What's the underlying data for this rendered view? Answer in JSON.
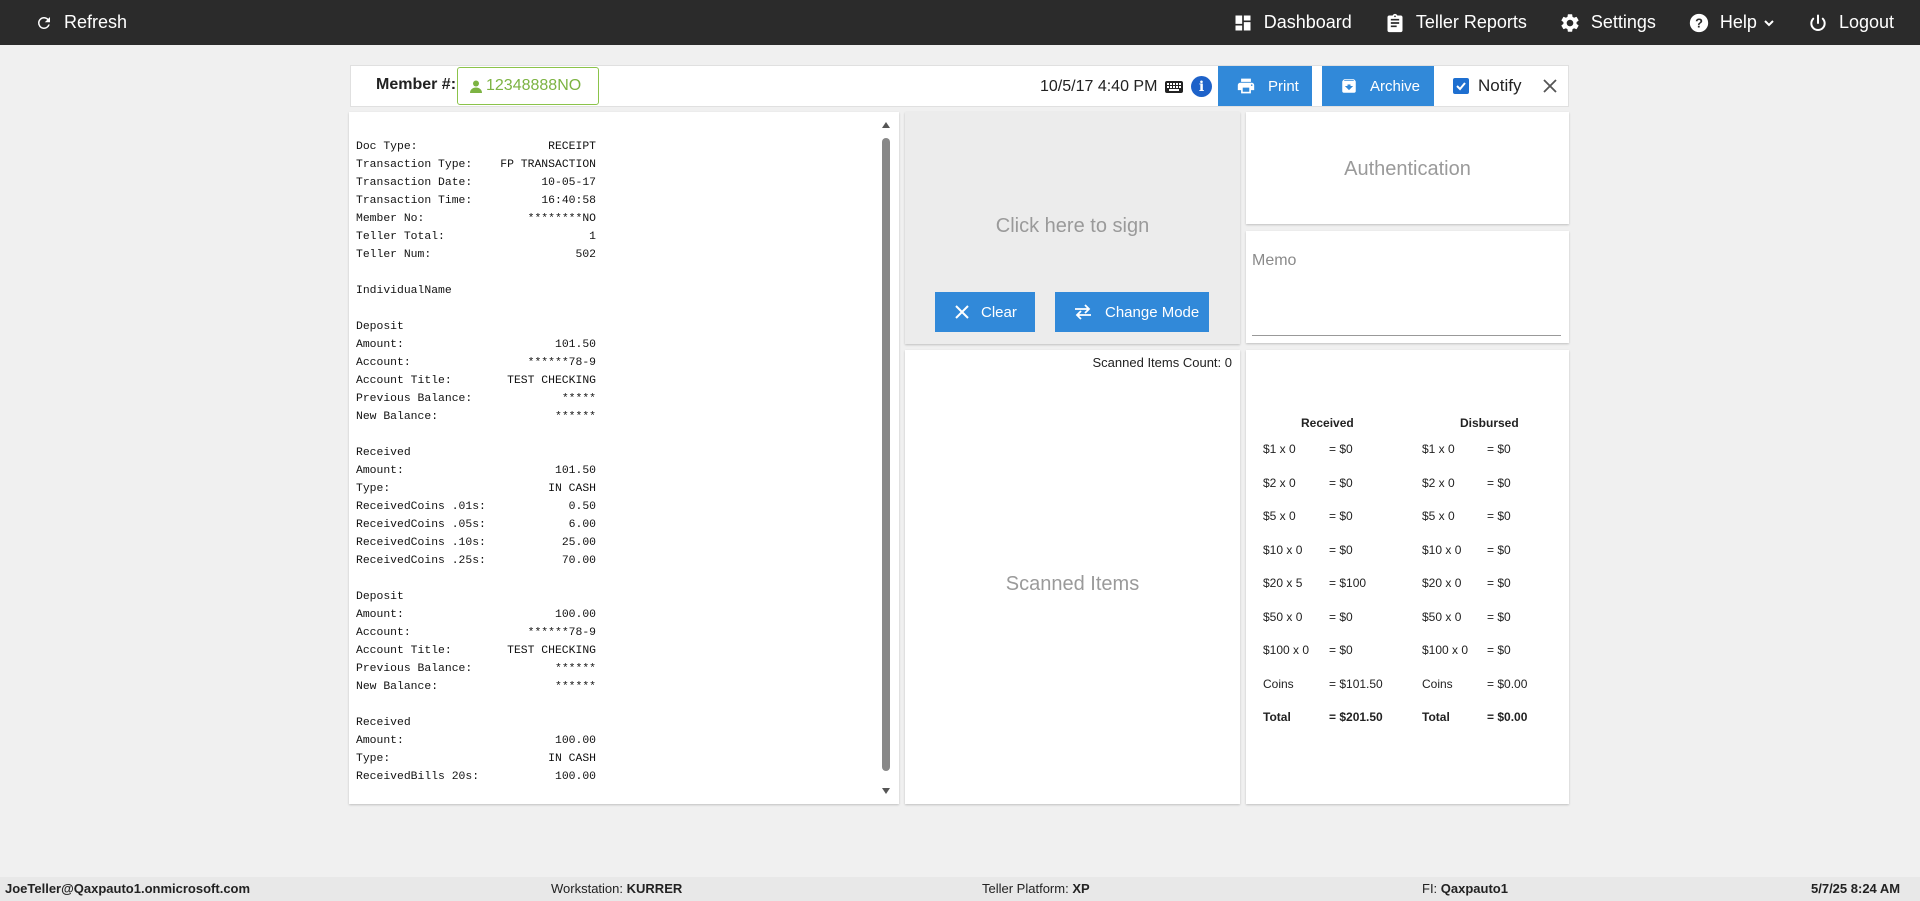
{
  "topbar": {
    "refresh_label": "Refresh",
    "dashboard_label": "Dashboard",
    "teller_reports_label": "Teller Reports",
    "settings_label": "Settings",
    "help_label": "Help",
    "logout_label": "Logout"
  },
  "header": {
    "member_label": "Member #:",
    "member_value": "12348888NO",
    "datetime": "10/5/17 4:40 PM",
    "print_label": "Print",
    "archive_label": "Archive",
    "notify_label": "Notify",
    "notify_checked": true
  },
  "receipt": {
    "lines": [
      [
        "Doc Type:",
        "RECEIPT"
      ],
      [
        "Transaction Type:",
        "FP TRANSACTION"
      ],
      [
        "Transaction Date:",
        "10-05-17"
      ],
      [
        "Transaction Time:",
        "16:40:58"
      ],
      [
        "Member No:",
        "********NO"
      ],
      [
        "Teller Total:",
        "1"
      ],
      [
        "Teller Num:",
        "502"
      ],
      [
        "",
        ""
      ],
      [
        "IndividualName",
        ""
      ],
      [
        "",
        ""
      ],
      [
        "Deposit",
        ""
      ],
      [
        "Amount:",
        "101.50"
      ],
      [
        "Account:",
        "******78-9"
      ],
      [
        "Account Title:",
        "TEST CHECKING"
      ],
      [
        "Previous Balance:",
        "*****"
      ],
      [
        "New Balance:",
        "******"
      ],
      [
        "",
        ""
      ],
      [
        "Received",
        ""
      ],
      [
        "Amount:",
        "101.50"
      ],
      [
        "Type:",
        "IN CASH"
      ],
      [
        "ReceivedCoins .01s:",
        "0.50"
      ],
      [
        "ReceivedCoins .05s:",
        "6.00"
      ],
      [
        "ReceivedCoins .10s:",
        "25.00"
      ],
      [
        "ReceivedCoins .25s:",
        "70.00"
      ],
      [
        "",
        ""
      ],
      [
        "Deposit",
        ""
      ],
      [
        "Amount:",
        "100.00"
      ],
      [
        "Account:",
        "******78-9"
      ],
      [
        "Account Title:",
        "TEST CHECKING"
      ],
      [
        "Previous Balance:",
        "******"
      ],
      [
        "New Balance:",
        "******"
      ],
      [
        "",
        ""
      ],
      [
        "Received",
        ""
      ],
      [
        "Amount:",
        "100.00"
      ],
      [
        "Type:",
        "IN CASH"
      ],
      [
        "ReceivedBills 20s:",
        "100.00"
      ]
    ]
  },
  "signature": {
    "prompt": "Click here to sign",
    "clear_label": "Clear",
    "change_mode_label": "Change Mode"
  },
  "scanned": {
    "count_label": "Scanned Items Count: 0",
    "title": "Scanned Items"
  },
  "authentication": {
    "label": "Authentication"
  },
  "memo": {
    "placeholder": "Memo"
  },
  "cash": {
    "received_header": "Received",
    "disbursed_header": "Disbursed",
    "rows": [
      {
        "r_denom": "$1 x 0",
        "r_val": "= $0",
        "d_denom": "$1 x 0",
        "d_val": "= $0"
      },
      {
        "r_denom": "$2 x 0",
        "r_val": "= $0",
        "d_denom": "$2 x 0",
        "d_val": "= $0"
      },
      {
        "r_denom": "$5 x 0",
        "r_val": "= $0",
        "d_denom": "$5 x 0",
        "d_val": "= $0"
      },
      {
        "r_denom": "$10 x 0",
        "r_val": "= $0",
        "d_denom": "$10 x 0",
        "d_val": "= $0"
      },
      {
        "r_denom": "$20 x 5",
        "r_val": "= $100",
        "d_denom": "$20 x 0",
        "d_val": "= $0"
      },
      {
        "r_denom": "$50 x 0",
        "r_val": "= $0",
        "d_denom": "$50 x 0",
        "d_val": "= $0"
      },
      {
        "r_denom": "$100 x 0",
        "r_val": "= $0",
        "d_denom": "$100 x 0",
        "d_val": "= $0"
      },
      {
        "r_denom": "Coins",
        "r_val": "= $101.50",
        "d_denom": "Coins",
        "d_val": "= $0.00"
      },
      {
        "r_denom": "Total",
        "r_val": "= $201.50",
        "d_denom": "Total",
        "d_val": "= $0.00"
      }
    ]
  },
  "footer": {
    "user": "JoeTeller@Qaxpauto1.onmicrosoft.com",
    "workstation_label": "Workstation:",
    "workstation_value": "KURRER",
    "platform_label": "Teller Platform:",
    "platform_value": "XP",
    "fi_label": "FI:",
    "fi_value": "Qaxpauto1",
    "datetime": "5/7/25 8:24 AM"
  },
  "colors": {
    "topbar_bg": "#2b2b2b",
    "primary_button": "#3189d9",
    "member_field_green": "#7cb342",
    "info_icon_blue": "#1e62c9"
  },
  "icons": [
    "refresh-icon",
    "dashboard-icon",
    "clipboard-icon",
    "gear-icon",
    "help-icon",
    "chevron-down-icon",
    "power-icon",
    "user-icon",
    "keyboard-icon",
    "info-icon",
    "printer-icon",
    "archive-icon",
    "checkbox-icon",
    "close-icon",
    "clear-icon",
    "swap-icon"
  ]
}
